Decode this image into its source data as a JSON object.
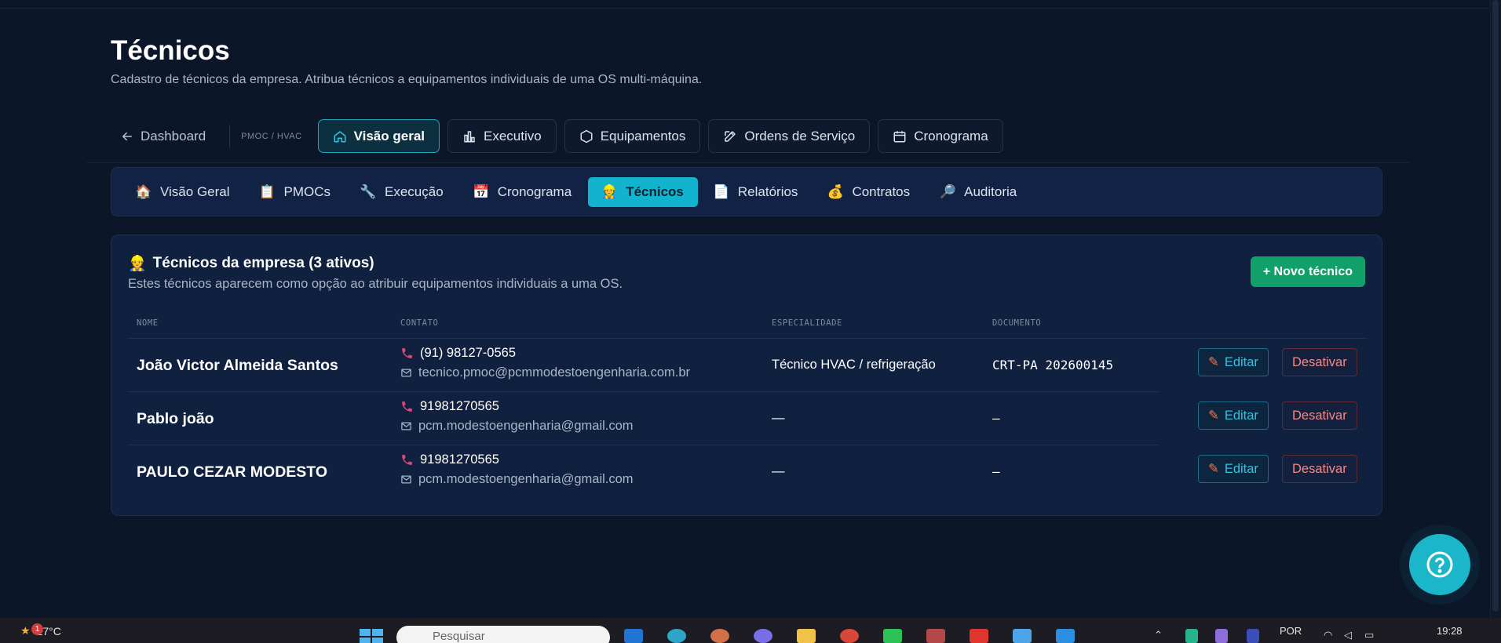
{
  "page": {
    "title": "Técnicos",
    "subtitle": "Cadastro de técnicos da empresa. Atribua técnicos a equipamentos individuais de uma OS multi-máquina."
  },
  "topnav": {
    "back_label": "Dashboard",
    "section_label": "PMOC / HVAC",
    "items": [
      {
        "label": "Visão geral",
        "icon": "home-icon",
        "active": true
      },
      {
        "label": "Executivo",
        "icon": "bar-chart-icon",
        "active": false
      },
      {
        "label": "Equipamentos",
        "icon": "hexagon-icon",
        "active": false
      },
      {
        "label": "Ordens de Serviço",
        "icon": "edit-icon",
        "active": false
      },
      {
        "label": "Cronograma",
        "icon": "calendar-icon",
        "active": false
      }
    ]
  },
  "subnav": {
    "items": [
      {
        "label": "Visão Geral",
        "emoji": "🏠",
        "active": false
      },
      {
        "label": "PMOCs",
        "emoji": "📋",
        "active": false
      },
      {
        "label": "Execução",
        "emoji": "🔧",
        "active": false
      },
      {
        "label": "Cronograma",
        "emoji": "📅",
        "active": false
      },
      {
        "label": "Técnicos",
        "emoji": "👷",
        "active": true
      },
      {
        "label": "Relatórios",
        "emoji": "📄",
        "active": false
      },
      {
        "label": "Contratos",
        "emoji": "💰",
        "active": false
      },
      {
        "label": "Auditoria",
        "emoji": "🔎",
        "active": false
      }
    ]
  },
  "card": {
    "emoji": "👷",
    "title": "Técnicos da empresa (3 ativos)",
    "description": "Estes técnicos aparecem como opção ao atribuir equipamentos individuais a uma OS.",
    "new_button": "+ Novo técnico"
  },
  "table": {
    "headers": {
      "nome": "NOME",
      "contato": "CONTATO",
      "especialidade": "ESPECIALIDADE",
      "documento": "DOCUMENTO"
    },
    "rows": [
      {
        "nome": "João Victor Almeida Santos",
        "telefone": "(91) 98127-0565",
        "email": "tecnico.pmoc@pcmmodestoengenharia.com.br",
        "especialidade": "Técnico HVAC / refrigeração",
        "documento": "CRT-PA 202600145",
        "edit_label": "Editar",
        "deactivate_label": "Desativar"
      },
      {
        "nome": "Pablo joão",
        "telefone": "91981270565",
        "email": "pcm.modestoengenharia@gmail.com",
        "especialidade": "—",
        "documento": "–",
        "edit_label": "Editar",
        "deactivate_label": "Desativar"
      },
      {
        "nome": "PAULO CEZAR MODESTO",
        "telefone": "91981270565",
        "email": "pcm.modestoengenharia@gmail.com",
        "especialidade": "—",
        "documento": "–",
        "edit_label": "Editar",
        "deactivate_label": "Desativar"
      }
    ]
  },
  "taskbar": {
    "weather": "27°C",
    "notification_count": "1",
    "search_placeholder": "Pesquisar",
    "language": "POR",
    "time": "19:28"
  },
  "colors": {
    "background": "#0b1628",
    "accent": "#12b3cf",
    "success": "#12a06a",
    "danger": "#f08a8a"
  }
}
